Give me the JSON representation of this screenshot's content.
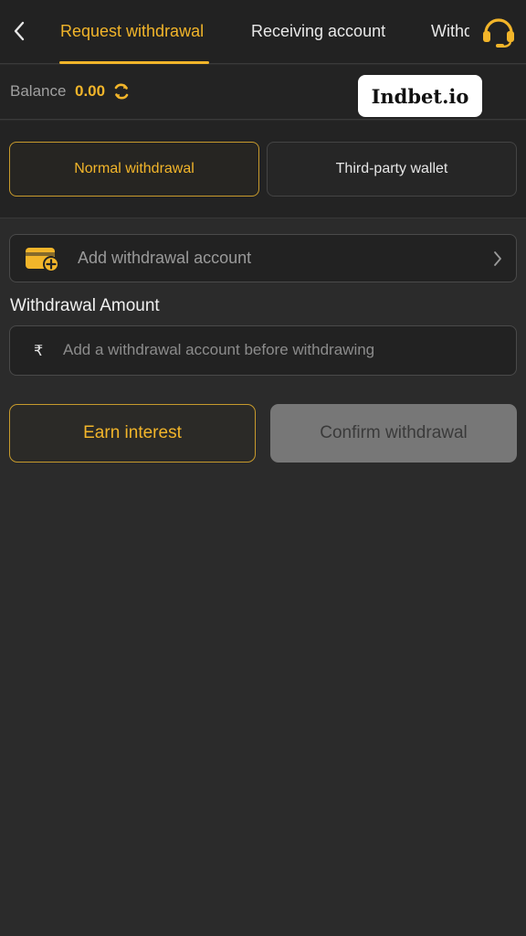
{
  "header": {
    "tabs": [
      {
        "label": "Request withdrawal",
        "active": true
      },
      {
        "label": "Receiving account",
        "active": false
      },
      {
        "label": "Withdrawal history",
        "active": false
      }
    ],
    "icons": {
      "back": "chevron-left-icon",
      "support": "headset-icon"
    }
  },
  "balance": {
    "label": "Balance",
    "value": "0.00",
    "refresh_icon": "refresh-icon"
  },
  "brand": {
    "text": "Indbet.io"
  },
  "methods": [
    {
      "label": "Normal withdrawal",
      "selected": true
    },
    {
      "label": "Third-party wallet",
      "selected": false
    }
  ],
  "account": {
    "label": "Add withdrawal account",
    "icon": "wallet-add-icon"
  },
  "amount": {
    "title": "Withdrawal Amount",
    "currency": "₹",
    "placeholder": "Add a withdrawal account before withdrawing"
  },
  "actions": {
    "earn_label": "Earn interest",
    "confirm_label": "Confirm withdrawal"
  },
  "colors": {
    "accent": "#f2b52a",
    "background": "#2b2b2b",
    "disabled": "#777777"
  }
}
